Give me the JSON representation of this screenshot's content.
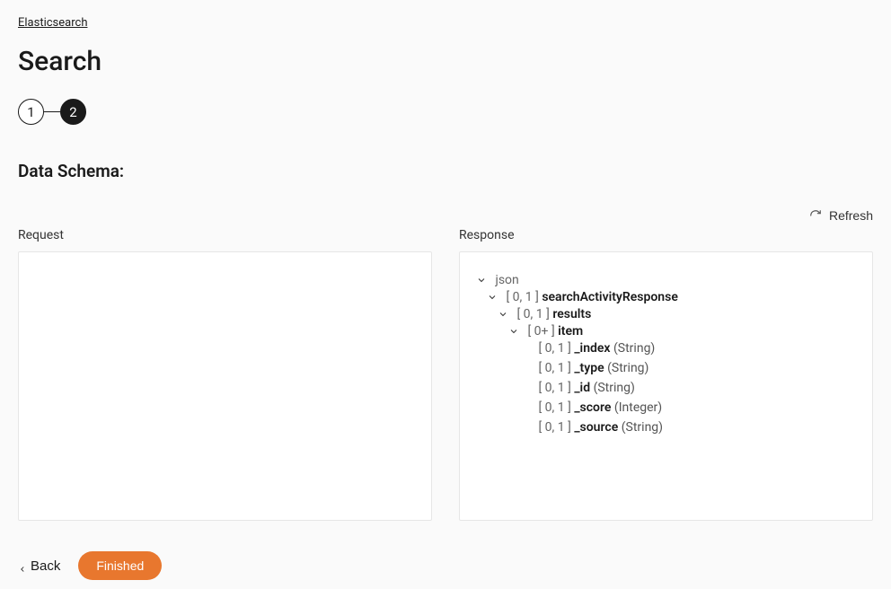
{
  "breadcrumb": {
    "root": "Elasticsearch"
  },
  "page_title": "Search",
  "stepper": {
    "step1": "1",
    "step2": "2"
  },
  "section_title": "Data Schema:",
  "refresh_label": "Refresh",
  "request_label": "Request",
  "response_label": "Response",
  "footer": {
    "back": "Back",
    "finished": "Finished"
  },
  "tree": {
    "n0": {
      "name": "json"
    },
    "n1": {
      "card": "[ 0, 1 ]",
      "name": "searchActivityResponse"
    },
    "n2": {
      "card": "[ 0, 1 ]",
      "name": "results"
    },
    "n3": {
      "card": "[ 0+ ]",
      "name": "item"
    },
    "n4": {
      "card": "[ 0, 1 ]",
      "name": "_index",
      "type": "(String)"
    },
    "n5": {
      "card": "[ 0, 1 ]",
      "name": "_type",
      "type": "(String)"
    },
    "n6": {
      "card": "[ 0, 1 ]",
      "name": "_id",
      "type": "(String)"
    },
    "n7": {
      "card": "[ 0, 1 ]",
      "name": "_score",
      "type": "(Integer)"
    },
    "n8": {
      "card": "[ 0, 1 ]",
      "name": "_source",
      "type": "(String)"
    }
  }
}
